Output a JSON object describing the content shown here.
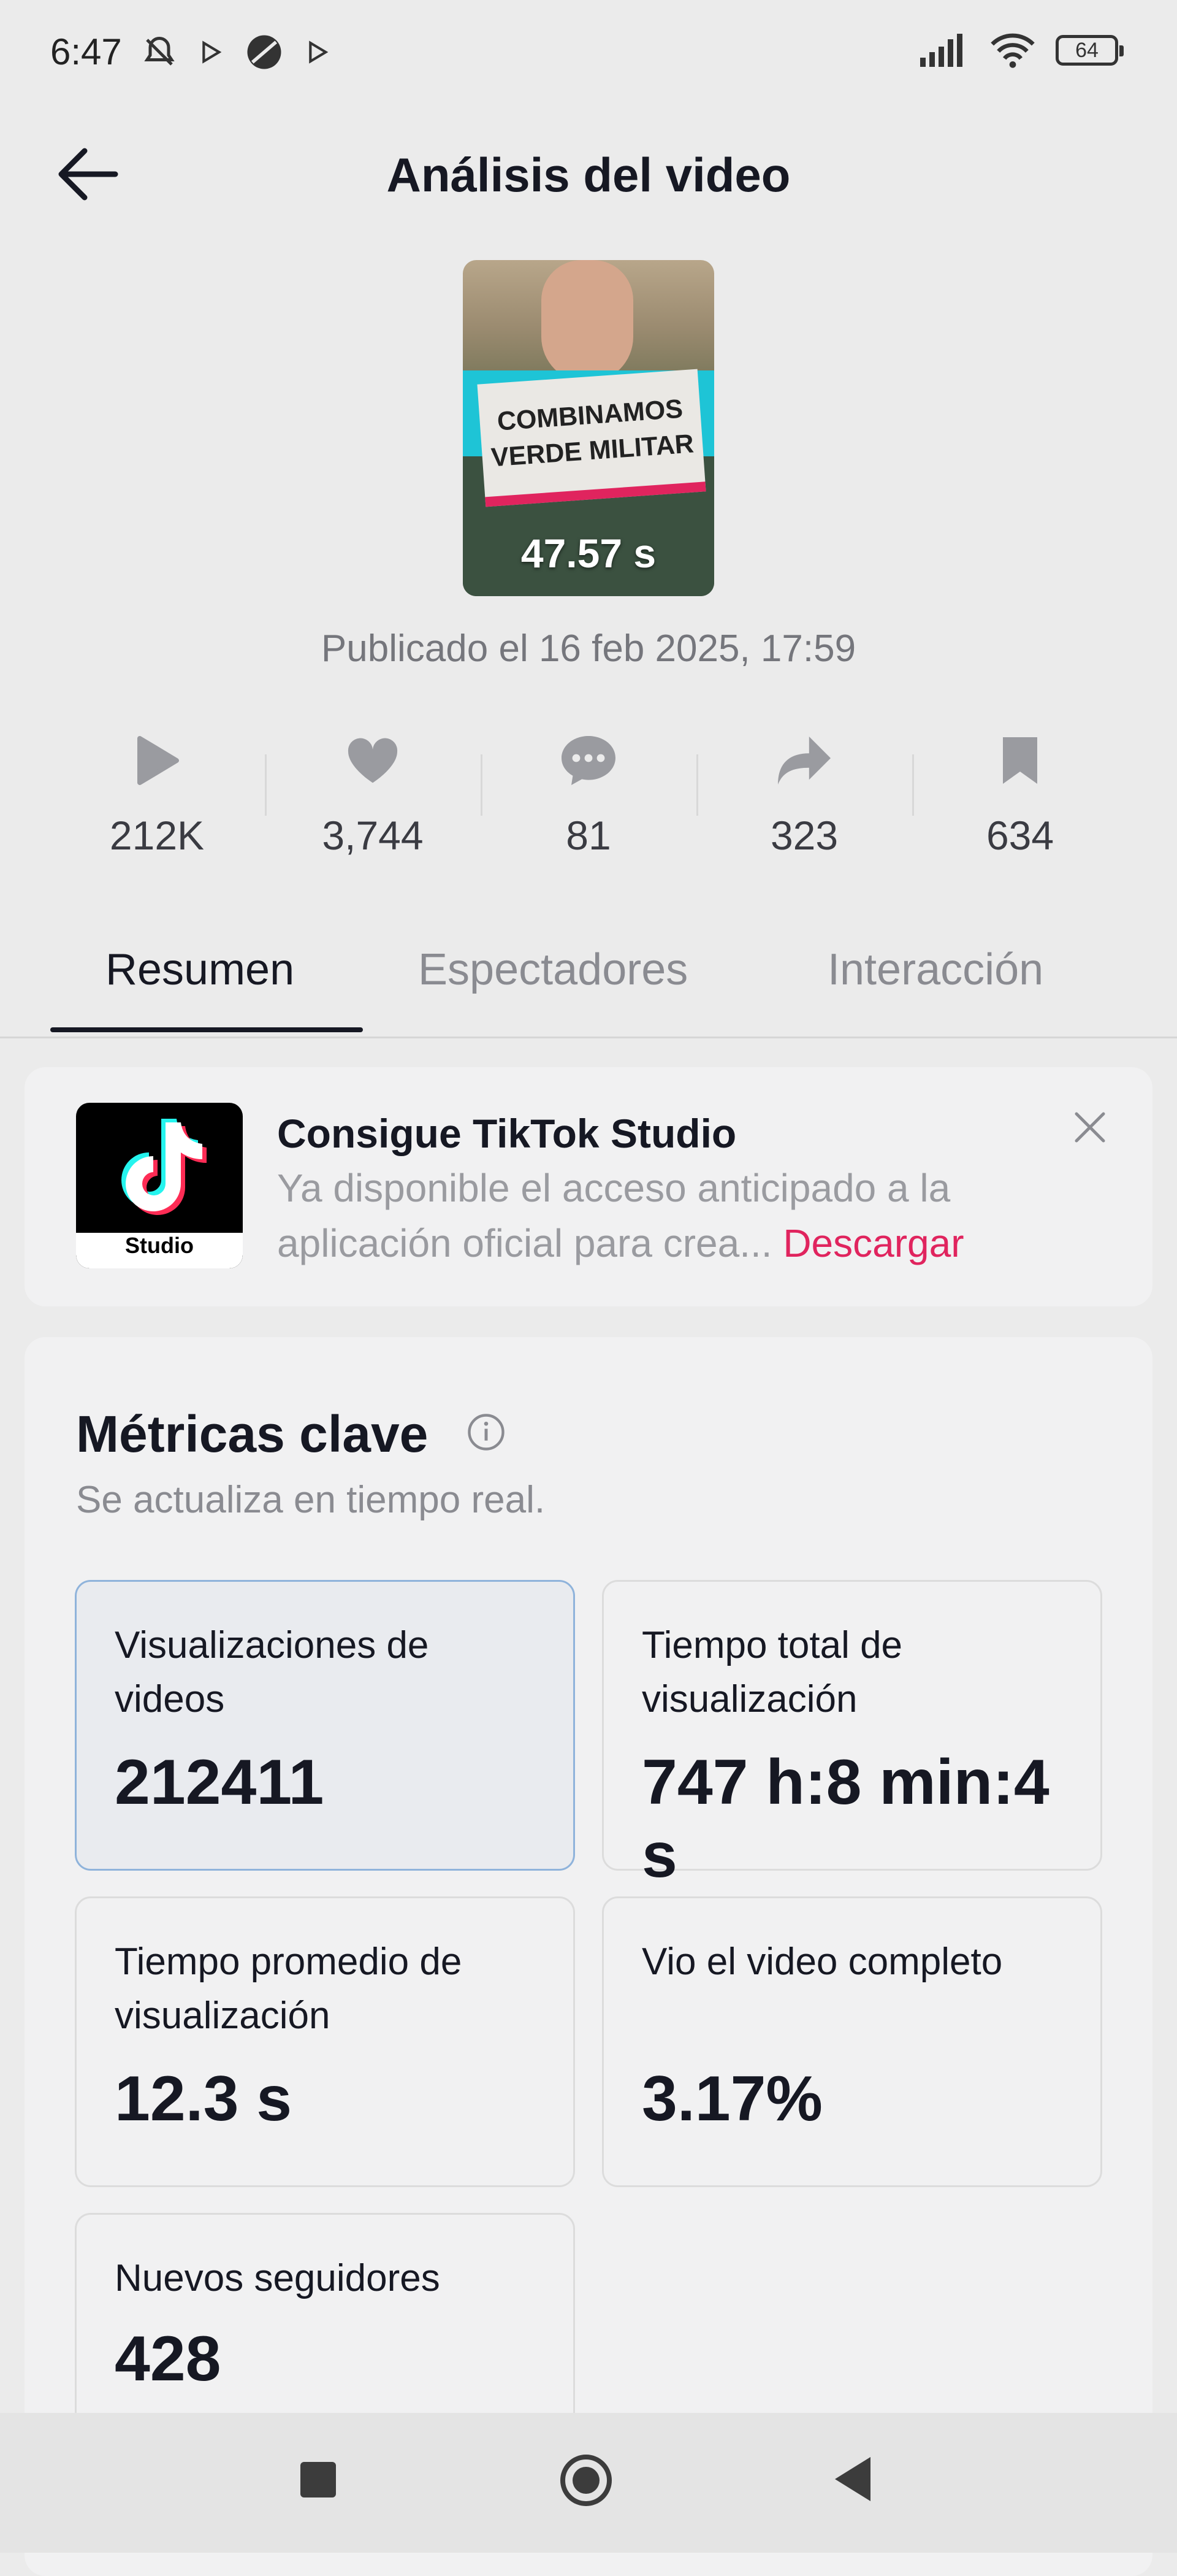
{
  "status_bar": {
    "time": "6:47",
    "battery": "64"
  },
  "header": {
    "title": "Análisis del video"
  },
  "video": {
    "thumbnail_text": "COMBINAMOS VERDE MILITAR",
    "duration": "47.57 s",
    "published": "Publicado el 16 feb 2025, 17:59"
  },
  "stats": {
    "views": "212K",
    "likes": "3,744",
    "comments": "81",
    "shares": "323",
    "saves": "634"
  },
  "tabs": [
    "Resumen",
    "Espectadores",
    "Interacción"
  ],
  "promo": {
    "title": "Consigue TikTok Studio",
    "text": "Ya disponible el acceso anticipado a la aplicación oficial para crea...",
    "link": "Descargar",
    "logo_text": "Studio"
  },
  "metrics": {
    "title": "Métricas clave",
    "subtitle": "Se actualiza en tiempo real.",
    "cards": [
      {
        "label": "Visualizaciones de videos",
        "value": "212411"
      },
      {
        "label": "Tiempo total de visualización",
        "value": "747 h:8 min:4 s"
      },
      {
        "label": "Tiempo promedio de visualización",
        "value": "12.3 s"
      },
      {
        "label": "Vio el video completo",
        "value": "3.17%"
      },
      {
        "label": "Nuevos seguidores",
        "value": "428"
      }
    ]
  },
  "colors": {
    "accent": "#e0245e",
    "text": "#161823",
    "muted": "#8a8b91"
  }
}
